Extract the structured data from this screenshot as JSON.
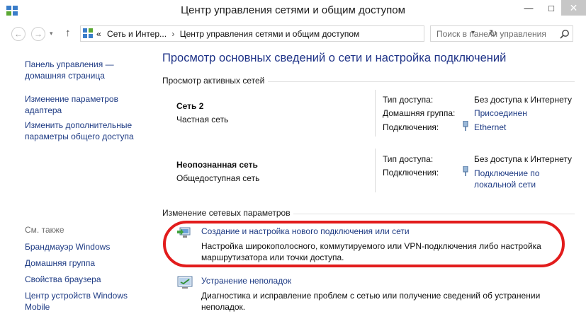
{
  "window": {
    "title": "Центр управления сетями и общим доступом",
    "minimize_glyph": "—",
    "maximize_glyph": "□",
    "close_glyph": "✕"
  },
  "nav": {
    "back_glyph": "←",
    "forward_glyph": "→",
    "recent_glyph": "▾",
    "up_glyph": "↑",
    "breadcrumb_prefix": "«",
    "breadcrumb": [
      "Сеть и Интер...",
      "Центр управления сетями и общим доступом"
    ],
    "breadcrumb_separator": "›",
    "address_dropdown_glyph": "▾",
    "refresh_glyph": "↻",
    "search_placeholder": "Поиск в панели управления"
  },
  "sidebar": {
    "links": [
      "Панель управления — домашняя страница",
      "Изменение параметров адаптера",
      "Изменить дополнительные параметры общего доступа"
    ],
    "see_also_label": "См. также",
    "see_also_links": [
      "Брандмауэр Windows",
      "Домашняя группа",
      "Свойства браузера",
      "Центр устройств Windows Mobile"
    ]
  },
  "main": {
    "heading": "Просмотр основных сведений о сети и настройка подключений",
    "active_section_label": "Просмотр активных сетей",
    "networks": [
      {
        "name": "Сеть  2",
        "type": "Частная сеть",
        "props": [
          {
            "label": "Тип доступа:",
            "value": "Без доступа к Интернету",
            "is_link": false
          },
          {
            "label": "Домашняя группа:",
            "value": "Присоединен",
            "is_link": true
          },
          {
            "label": "Подключения:",
            "value": "Ethernet",
            "is_link": true
          }
        ]
      },
      {
        "name": "Неопознанная сеть",
        "type": "Общедоступная сеть",
        "props": [
          {
            "label": "Тип доступа:",
            "value": "Без доступа к Интернету",
            "is_link": false
          },
          {
            "label": "Подключения:",
            "value": "Подключение по локальной сети",
            "is_link": true
          }
        ]
      }
    ],
    "change_section_label": "Изменение сетевых параметров",
    "tasks": [
      {
        "title": "Создание и настройка нового подключения или сети",
        "description": "Настройка широкополосного, коммутируемого или VPN-подключения либо настройка маршрутизатора или точки доступа."
      },
      {
        "title": "Устранение неполадок",
        "description": "Диагностика и исправление проблем с сетью или получение сведений об устранении неполадок."
      }
    ]
  },
  "colors": {
    "link": "#1e3b84",
    "heading": "#1e3287",
    "highlight": "#e21c1c"
  }
}
